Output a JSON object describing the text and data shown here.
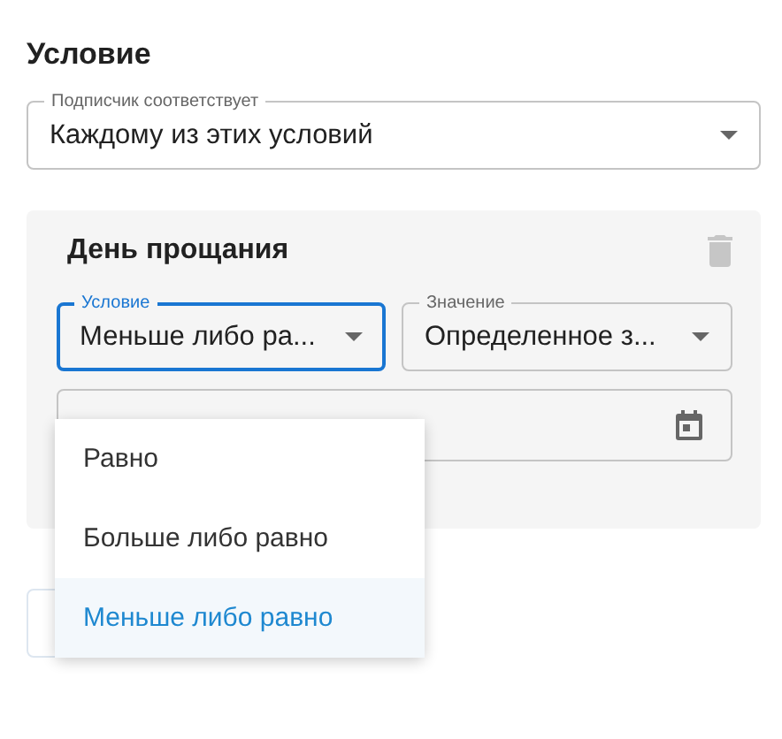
{
  "section_title": "Условие",
  "match_select": {
    "label": "Подписчик соответствует",
    "value": "Каждому из этих условий"
  },
  "condition_card": {
    "title": "День прощания",
    "condition_select": {
      "label": "Условие",
      "value": "Меньше либо ра...",
      "focused": true
    },
    "value_select": {
      "label": "Значение",
      "value": "Определенное з..."
    }
  },
  "dropdown_options": [
    {
      "label": "Равно",
      "selected": false
    },
    {
      "label": "Больше либо равно",
      "selected": false
    },
    {
      "label": "Меньше либо равно",
      "selected": true
    }
  ]
}
